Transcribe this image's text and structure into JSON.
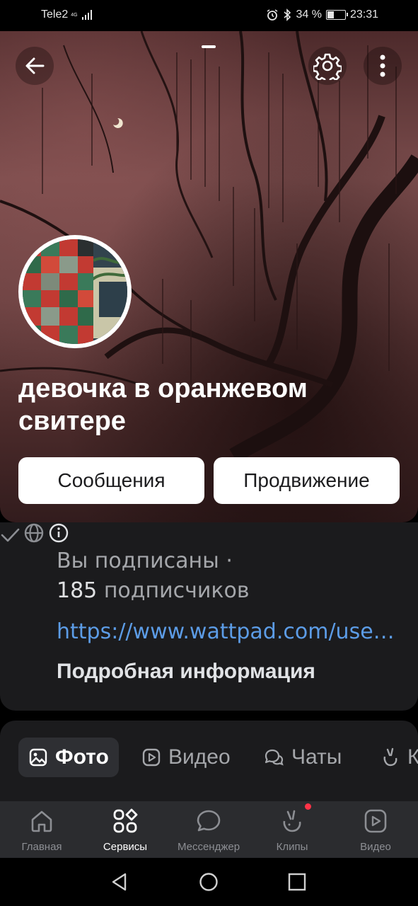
{
  "status_bar": {
    "carrier": "Tele2",
    "network": "4G",
    "battery": "34 %",
    "time": "23:31"
  },
  "hero": {
    "profile_name": "девочка в оранжевом свитере",
    "buttons": {
      "messages": "Сообщения",
      "promotion": "Продвижение"
    }
  },
  "info": {
    "subscribed": "Вы подписаны ·",
    "followers_count": "185",
    "followers_label": "подписчиков",
    "link": "https://www.wattpad.com/user/...",
    "more_info": "Подробная информация"
  },
  "tabs": [
    {
      "label": "Фото",
      "icon": "image-icon",
      "active": true
    },
    {
      "label": "Видео",
      "icon": "video-icon",
      "active": false
    },
    {
      "label": "Чаты",
      "icon": "chats-icon",
      "active": false
    },
    {
      "label": "К",
      "icon": "clips-icon",
      "active": false
    }
  ],
  "bottom_nav": [
    {
      "label": "Главная",
      "icon": "home-icon"
    },
    {
      "label": "Сервисы",
      "icon": "services-icon",
      "active": true
    },
    {
      "label": "Мессенджер",
      "icon": "messenger-icon"
    },
    {
      "label": "Клипы",
      "icon": "clips-icon",
      "badge": true
    },
    {
      "label": "Видео",
      "icon": "video-icon"
    }
  ],
  "colors": {
    "background": "#000000",
    "card": "#1b1b1d",
    "link": "#5c9ce6",
    "accent_dot": "#ff3347"
  }
}
